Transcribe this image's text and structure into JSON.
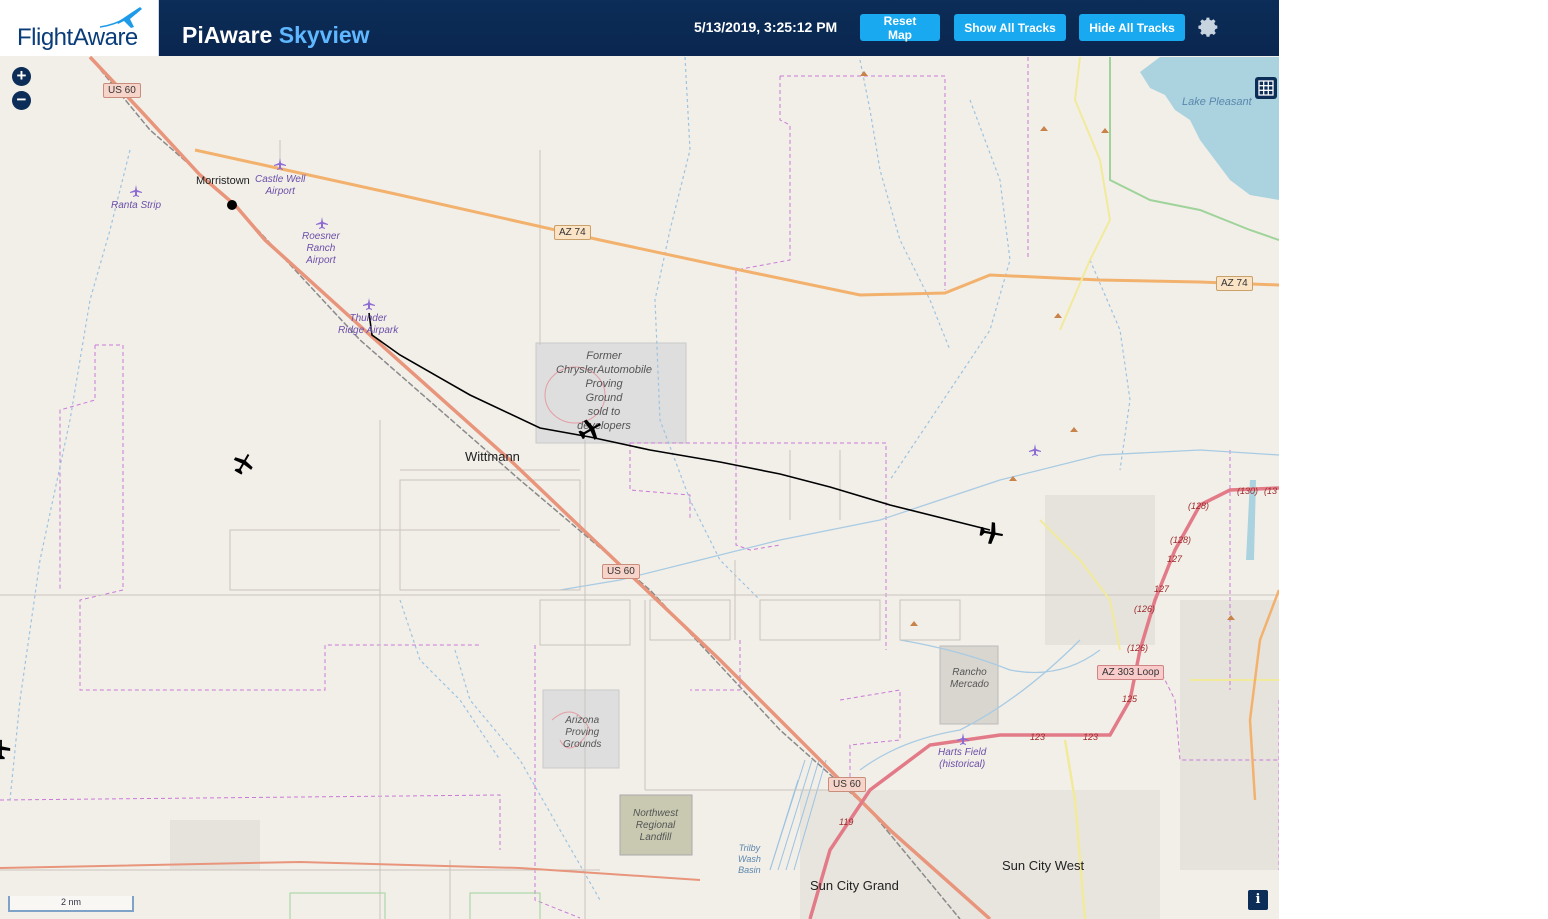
{
  "header": {
    "logo_text": "FlightAware",
    "title_main": "PiAware",
    "title_accent": "Skyview",
    "clock": "5/13/2019, 3:25:12 PM",
    "buttons": {
      "reset": "Reset Map",
      "show_tracks": "Show All Tracks",
      "hide_tracks": "Hide All Tracks"
    }
  },
  "map": {
    "zoom_in": "+",
    "zoom_out": "−",
    "info": "i",
    "scale_label": "2 nm",
    "places": {
      "morristown": "Morristown",
      "wittmann": "Wittmann",
      "sun_city_grand": "Sun City Grand",
      "sun_city_west": "Sun City West"
    },
    "water": {
      "lake_pleasant": "Lake Pleasant",
      "trilby": "Trilby\nWash\nBasin"
    },
    "airports": {
      "ranta": "Ranta Strip",
      "castle_well": "Castle Well\nAirport",
      "roesner": "Roesner\nRanch\nAirport",
      "thunder_ridge": "Thunder\nRidge Airpark",
      "harts": "Harts Field\n(historical)"
    },
    "areas": {
      "chrysler": "Former\nChryslerAutomobile\nProving\nGround\nsold to\ndevelopers",
      "arizona_pg": "Arizona\nProving\nGrounds",
      "landfill": "Northwest\nRegional\nLandfill",
      "rancho": "Rancho\nMercado"
    },
    "shields": {
      "us60_a": "US 60",
      "us60_b": "US 60",
      "us60_c": "US 60",
      "az74_a": "AZ 74",
      "az74_b": "AZ 74",
      "az303": "AZ 303 Loop"
    },
    "exits": [
      "(130)",
      "(13",
      "(128)",
      "(128)",
      "127",
      "127",
      "(126)",
      "(126)",
      "125",
      "123",
      "123",
      "119"
    ]
  },
  "colors": {
    "header_bg": "#0b2d57",
    "button_bg": "#18a9f0",
    "accent_title": "#5fb8ff",
    "map_bg": "#f2efe9",
    "track": "#000000"
  }
}
